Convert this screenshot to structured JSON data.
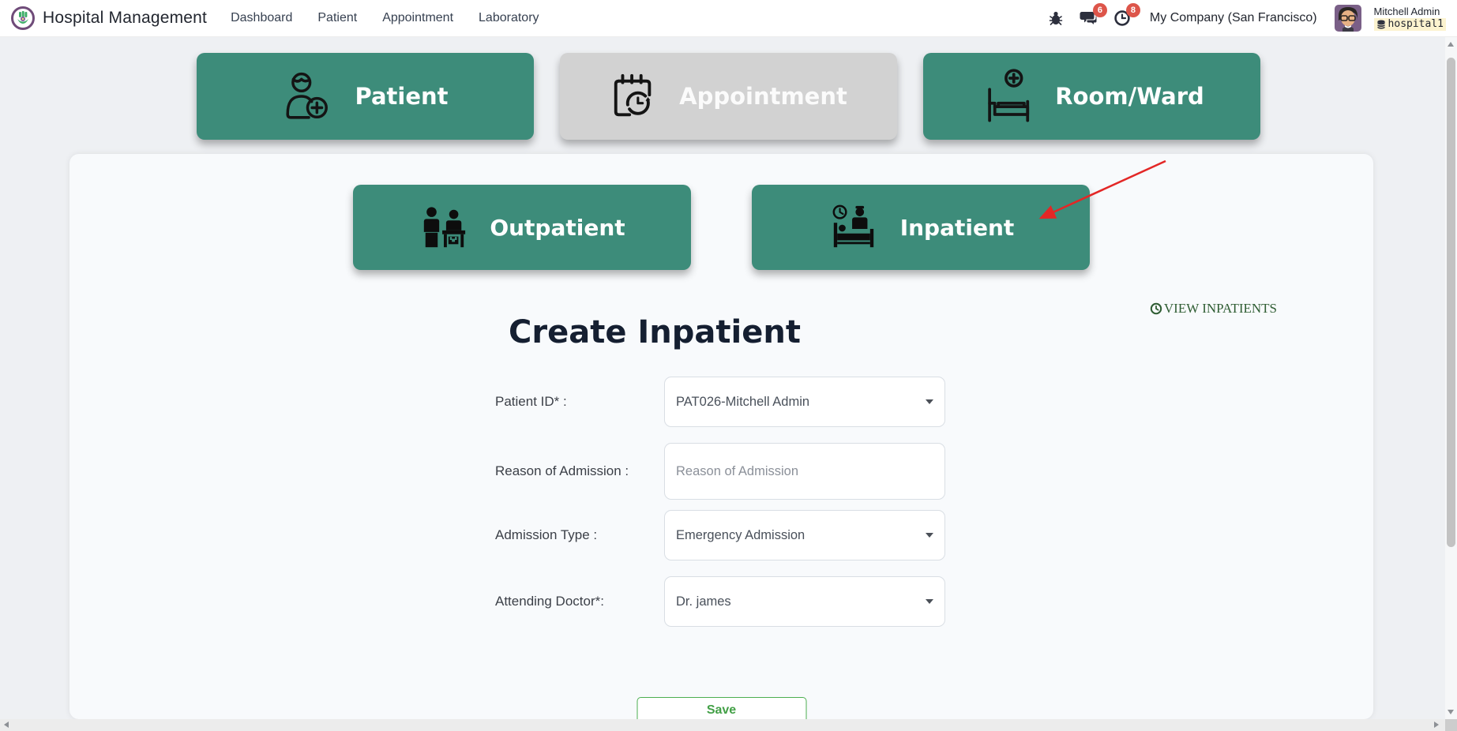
{
  "navbar": {
    "brand": "Hospital Management",
    "menu": [
      "Dashboard",
      "Patient",
      "Appointment",
      "Laboratory"
    ],
    "badges": {
      "messages": "6",
      "activities": "8"
    },
    "company": "My Company (San Francisco)",
    "user_name": "Mitchell Admin",
    "database": "hospital1"
  },
  "module_tabs": {
    "patient": "Patient",
    "appointment": "Appointment",
    "room_ward": "Room/Ward"
  },
  "sub_tabs": {
    "outpatient": "Outpatient",
    "inpatient": "Inpatient"
  },
  "view_link_label": "VIEW INPATIENTS",
  "form": {
    "title": "Create Inpatient",
    "fields": [
      {
        "label": "Patient ID* :",
        "value": "PAT026-Mitchell Admin",
        "type": "select"
      },
      {
        "label": "Reason of Admission :",
        "placeholder": "Reason of Admission",
        "value": "",
        "type": "text"
      },
      {
        "label": "Admission Type :",
        "value": "Emergency Admission",
        "type": "select"
      },
      {
        "label": "Attending Doctor*:",
        "value": "Dr. james",
        "type": "select"
      }
    ],
    "save_label": "Save"
  },
  "colors": {
    "primary_green": "#3d8c7a",
    "disabled_gray": "#d2d2d2",
    "badge_red": "#dd554a",
    "link_green": "#2f5d33",
    "save_green": "#43a047",
    "arrow_red": "#e32726"
  }
}
